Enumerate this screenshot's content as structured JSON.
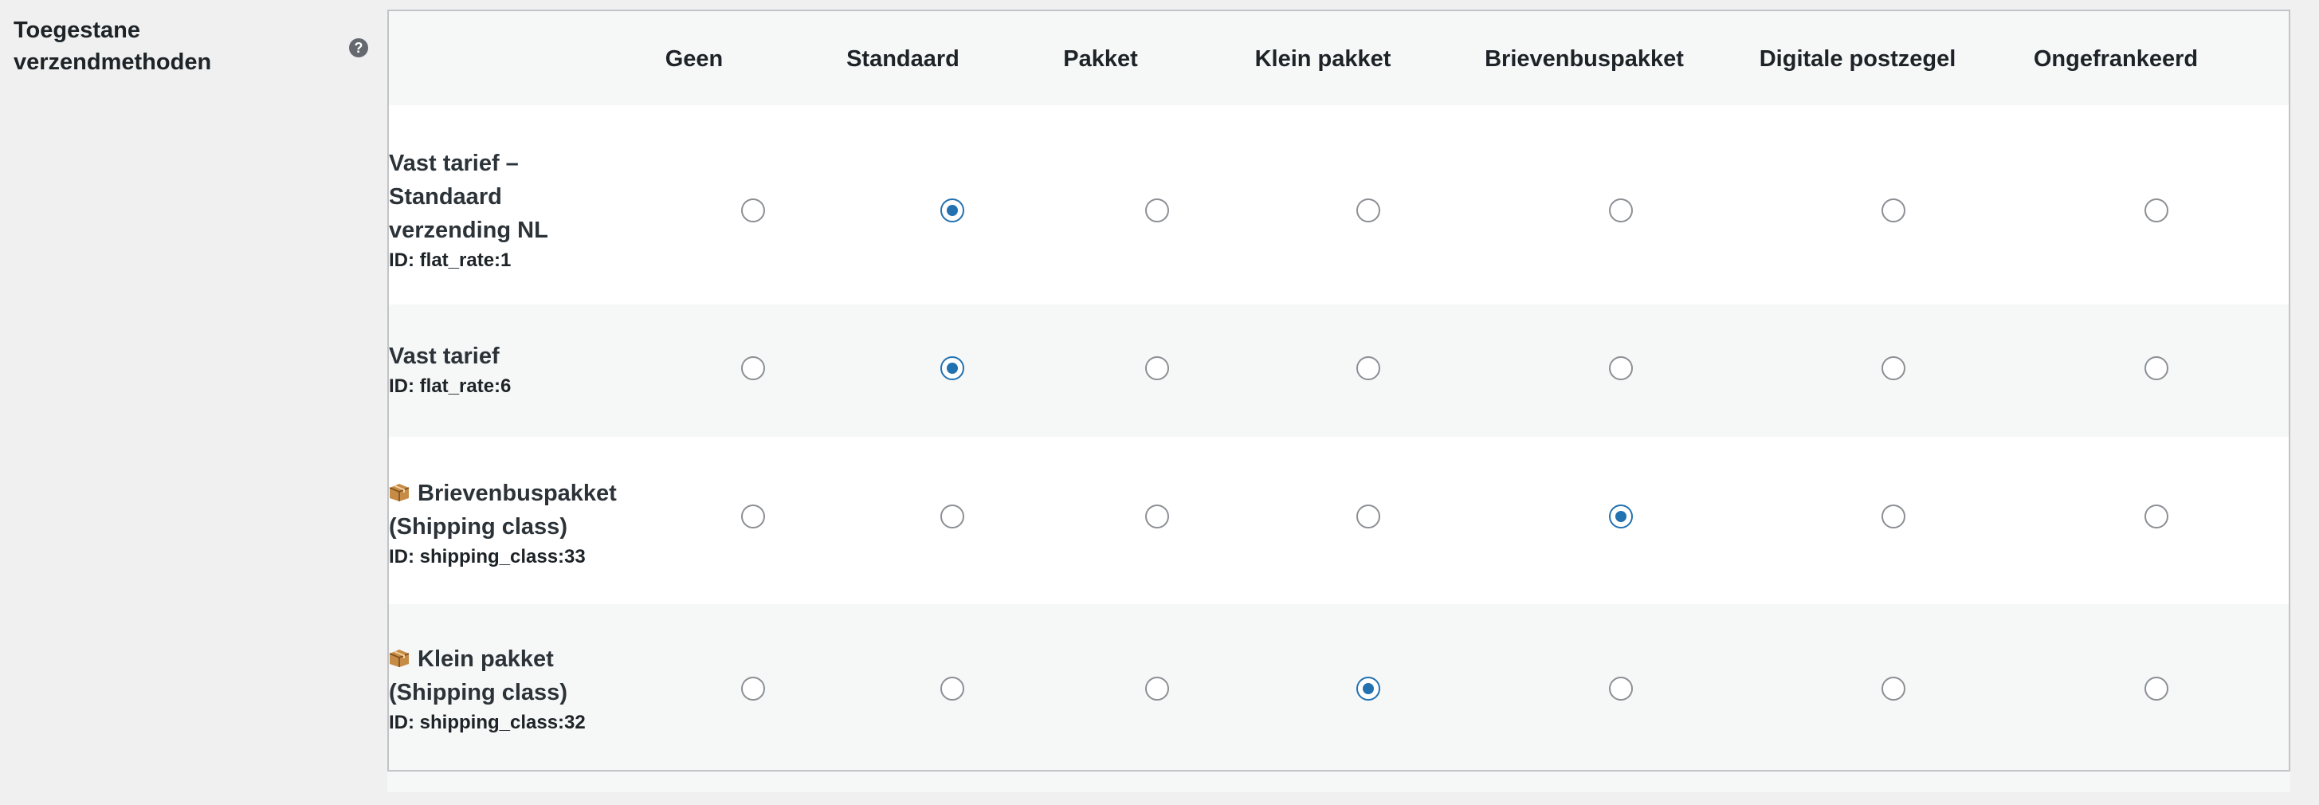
{
  "field": {
    "label": "Toegestane verzendmethoden",
    "help_icon": "question-circle-icon"
  },
  "columns": [
    "Geen",
    "Standaard",
    "Pakket",
    "Klein pakket",
    "Brievenbuspakket",
    "Digitale postzegel",
    "Ongefrankeerd"
  ],
  "rows": [
    {
      "name": "Vast tarief – Standaard verzending NL",
      "id_text": "ID: flat_rate:1",
      "icon": "",
      "selected": "Standaard"
    },
    {
      "name": "Vast tarief",
      "id_text": "ID: flat_rate:6",
      "icon": "",
      "selected": "Standaard"
    },
    {
      "name": "Brievenbuspakket (Shipping class)",
      "id_text": "ID: shipping_class:33",
      "icon": "package-icon",
      "selected": "Brievenbuspakket"
    },
    {
      "name": "Klein pakket (Shipping class)",
      "id_text": "ID: shipping_class:32",
      "icon": "package-icon",
      "selected": "Klein pakket"
    }
  ],
  "colors": {
    "accent": "#2271b1",
    "radio_border": "#8c8f94",
    "row_alt": "#f6f7f7",
    "page_bg": "#f0f0f1"
  }
}
